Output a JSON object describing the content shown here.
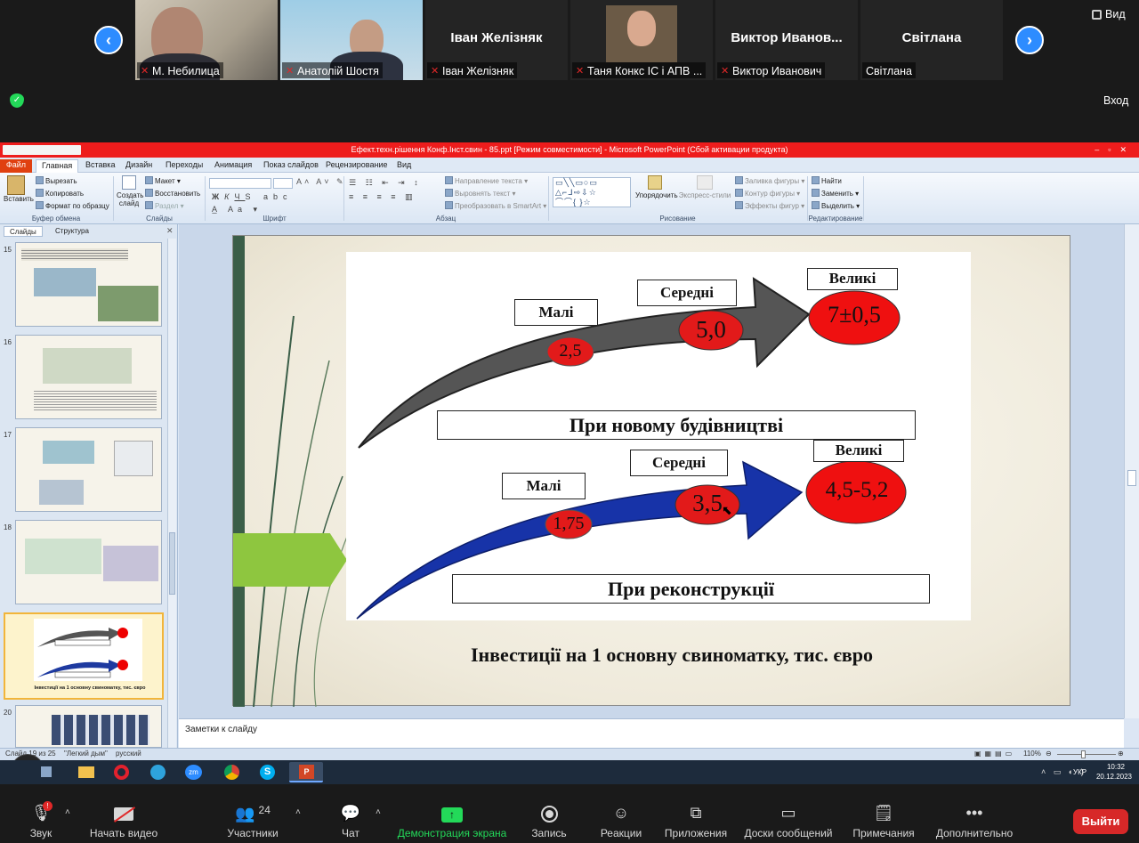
{
  "participants": [
    {
      "name": "М. Небилица",
      "display": ""
    },
    {
      "name": "Анатолій Шостя",
      "display": ""
    },
    {
      "name": "Іван Желізняк",
      "display": "Іван Желізняк"
    },
    {
      "name": "Таня Конкс ІС і АПВ ...",
      "display": ""
    },
    {
      "name": "Виктор Иванович",
      "display": "Виктор  Иванов..."
    },
    {
      "name": "Світлана",
      "display": "Світлана"
    }
  ],
  "view_label": "Вид",
  "enter_label": "Вход",
  "ppt": {
    "title": "Ефект.техн.рішення Конф.Інст.свин - 85.ppt [Режим совместимости] - Microsoft PowerPoint (Сбой активации продукта)",
    "tabs": [
      "Файл",
      "Главная",
      "Вставка",
      "Дизайн",
      "Переходы",
      "Анимация",
      "Показ слайдов",
      "Рецензирование",
      "Вид"
    ],
    "ribbon": {
      "paste": "Вставить",
      "cut": "Вырезать",
      "copy": "Копировать",
      "format_painter": "Формат по образцу",
      "clipboard_group": "Буфер обмена",
      "new_slide": "Создать слайд",
      "layout": "Макет",
      "reset": "Восстановить",
      "section": "Раздел",
      "slides_group": "Слайды",
      "font_group": "Шрифт",
      "text_direction": "Направление текста",
      "align_text": "Выровнять текст",
      "smartart": "Преобразовать в SmartArt",
      "paragraph_group": "Абзац",
      "arrange": "Упорядочить",
      "quick_styles": "Экспресс-стили",
      "shape_fill": "Заливка фигуры",
      "shape_outline": "Контур фигуры",
      "shape_effects": "Эффекты фигур",
      "drawing_group": "Рисование",
      "find": "Найти",
      "replace": "Заменить",
      "select": "Выделить",
      "editing_group": "Редактирование"
    },
    "side_tabs": [
      "Слайды",
      "Структура"
    ],
    "slide_numbers": [
      "15",
      "16",
      "17",
      "18",
      "19",
      "20"
    ],
    "thumb19": {
      "caption": "Інвестиції на 1 основну свиноматку, тис. євро"
    },
    "slide": {
      "top_row": {
        "small": "Малі",
        "medium": "Середні",
        "large": "Великі",
        "v_small": "2,5",
        "v_medium": "5,0",
        "v_large": "7±0,5",
        "caption": "При новому будівництві"
      },
      "bottom_row": {
        "small": "Малі",
        "medium": "Середні",
        "large": "Великі",
        "v_small": "1,75",
        "v_medium": "3,5",
        "v_large": "4,5-5,2",
        "caption": "При реконструкції"
      },
      "title": "Інвестиції на 1 основну свиноматку, тис. євро"
    },
    "notes_placeholder": "Заметки к слайду",
    "status": {
      "slide_of": "Слайд 19 из 25",
      "theme": "\"Легкий дым\"",
      "lang": "русский",
      "zoom": "110%"
    }
  },
  "taskbar": {
    "lang": "УКР",
    "time": "10:32",
    "date": "20.12.2023"
  },
  "controls": {
    "audio": "Звук",
    "video": "Начать видео",
    "participants": "Участники",
    "participants_count": "24",
    "chat": "Чат",
    "share": "Демонстрация экрана",
    "record": "Запись",
    "reactions": "Реакции",
    "apps": "Приложения",
    "whiteboards": "Доски сообщений",
    "notes": "Примечания",
    "more": "Дополнительно",
    "leave": "Выйти"
  },
  "colors": {
    "zoom_blue": "#2d8cff",
    "share_green": "#23d959",
    "leave_red": "#d72828",
    "ppt_title_red": "#ee1c1c"
  }
}
